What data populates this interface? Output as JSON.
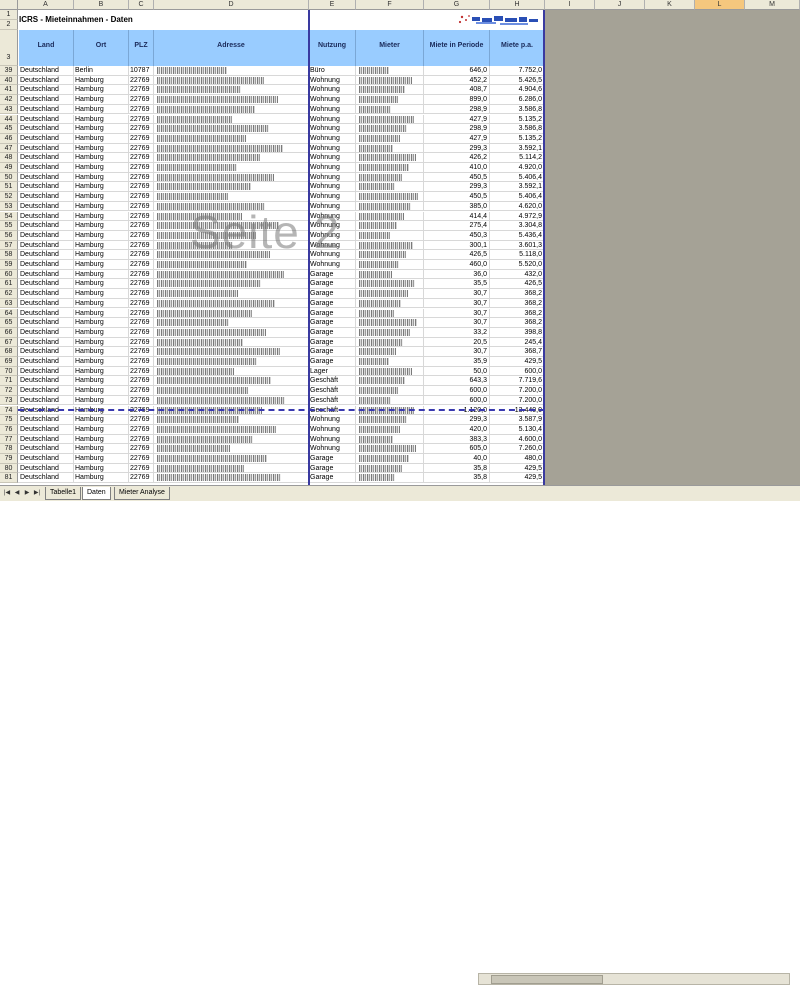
{
  "title": "ICRS - Mieteinnahmen - Daten",
  "watermark": "Seite 2",
  "columns": [
    "A",
    "B",
    "C",
    "D",
    "E",
    "F",
    "G",
    "H",
    "I",
    "J",
    "K",
    "L",
    "M"
  ],
  "selected_column": "L",
  "header_rows": [
    "1",
    "2"
  ],
  "header_label_row": "3",
  "headers": {
    "land": "Land",
    "ort": "Ort",
    "plz": "PLZ",
    "adresse": "Adresse",
    "nutzung": "Nutzung",
    "mieter": "Mieter",
    "miete_periode": "Miete in Periode",
    "miete_pa": "Miete p.a."
  },
  "rows": [
    {
      "n": "39",
      "land": "Deutschland",
      "ort": "Berlin",
      "plz": "10787",
      "nutzung": "Büro",
      "periode": "646,0",
      "pa": "7.752,0"
    },
    {
      "n": "40",
      "land": "Deutschland",
      "ort": "Hamburg",
      "plz": "22769",
      "nutzung": "Wohnung",
      "periode": "452,2",
      "pa": "5.426,5"
    },
    {
      "n": "41",
      "land": "Deutschland",
      "ort": "Hamburg",
      "plz": "22769",
      "nutzung": "Wohnung",
      "periode": "408,7",
      "pa": "4.904,6"
    },
    {
      "n": "42",
      "land": "Deutschland",
      "ort": "Hamburg",
      "plz": "22769",
      "nutzung": "Wohnung",
      "periode": "899,0",
      "pa": "6.286,0"
    },
    {
      "n": "43",
      "land": "Deutschland",
      "ort": "Hamburg",
      "plz": "22769",
      "nutzung": "Wohnung",
      "periode": "298,9",
      "pa": "3.586,8"
    },
    {
      "n": "44",
      "land": "Deutschland",
      "ort": "Hamburg",
      "plz": "22769",
      "nutzung": "Wohnung",
      "periode": "427,9",
      "pa": "5.135,2"
    },
    {
      "n": "45",
      "land": "Deutschland",
      "ort": "Hamburg",
      "plz": "22769",
      "nutzung": "Wohnung",
      "periode": "298,9",
      "pa": "3.586,8"
    },
    {
      "n": "46",
      "land": "Deutschland",
      "ort": "Hamburg",
      "plz": "22769",
      "nutzung": "Wohnung",
      "periode": "427,9",
      "pa": "5.135,2"
    },
    {
      "n": "47",
      "land": "Deutschland",
      "ort": "Hamburg",
      "plz": "22769",
      "nutzung": "Wohnung",
      "periode": "299,3",
      "pa": "3.592,1"
    },
    {
      "n": "48",
      "land": "Deutschland",
      "ort": "Hamburg",
      "plz": "22769",
      "nutzung": "Wohnung",
      "periode": "426,2",
      "pa": "5.114,2"
    },
    {
      "n": "49",
      "land": "Deutschland",
      "ort": "Hamburg",
      "plz": "22769",
      "nutzung": "Wohnung",
      "periode": "410,0",
      "pa": "4.920,0"
    },
    {
      "n": "50",
      "land": "Deutschland",
      "ort": "Hamburg",
      "plz": "22769",
      "nutzung": "Wohnung",
      "periode": "450,5",
      "pa": "5.406,4"
    },
    {
      "n": "51",
      "land": "Deutschland",
      "ort": "Hamburg",
      "plz": "22769",
      "nutzung": "Wohnung",
      "periode": "299,3",
      "pa": "3.592,1"
    },
    {
      "n": "52",
      "land": "Deutschland",
      "ort": "Hamburg",
      "plz": "22769",
      "nutzung": "Wohnung",
      "periode": "450,5",
      "pa": "5.406,4"
    },
    {
      "n": "53",
      "land": "Deutschland",
      "ort": "Hamburg",
      "plz": "22769",
      "nutzung": "Wohnung",
      "periode": "385,0",
      "pa": "4.620,0"
    },
    {
      "n": "54",
      "land": "Deutschland",
      "ort": "Hamburg",
      "plz": "22769",
      "nutzung": "Wohnung",
      "periode": "414,4",
      "pa": "4.972,9"
    },
    {
      "n": "55",
      "land": "Deutschland",
      "ort": "Hamburg",
      "plz": "22769",
      "nutzung": "Wohnung",
      "periode": "275,4",
      "pa": "3.304,8"
    },
    {
      "n": "56",
      "land": "Deutschland",
      "ort": "Hamburg",
      "plz": "22769",
      "nutzung": "Wohnung",
      "periode": "450,3",
      "pa": "5.436,4"
    },
    {
      "n": "57",
      "land": "Deutschland",
      "ort": "Hamburg",
      "plz": "22769",
      "nutzung": "Wohnung",
      "periode": "300,1",
      "pa": "3.601,3"
    },
    {
      "n": "58",
      "land": "Deutschland",
      "ort": "Hamburg",
      "plz": "22769",
      "nutzung": "Wohnung",
      "periode": "426,5",
      "pa": "5.118,0"
    },
    {
      "n": "59",
      "land": "Deutschland",
      "ort": "Hamburg",
      "plz": "22769",
      "nutzung": "Wohnung",
      "periode": "460,0",
      "pa": "5.520,0"
    },
    {
      "n": "60",
      "land": "Deutschland",
      "ort": "Hamburg",
      "plz": "22769",
      "nutzung": "Garage",
      "periode": "36,0",
      "pa": "432,0"
    },
    {
      "n": "61",
      "land": "Deutschland",
      "ort": "Hamburg",
      "plz": "22769",
      "nutzung": "Garage",
      "periode": "35,5",
      "pa": "426,5"
    },
    {
      "n": "62",
      "land": "Deutschland",
      "ort": "Hamburg",
      "plz": "22769",
      "nutzung": "Garage",
      "periode": "30,7",
      "pa": "368,2"
    },
    {
      "n": "63",
      "land": "Deutschland",
      "ort": "Hamburg",
      "plz": "22769",
      "nutzung": "Garage",
      "periode": "30,7",
      "pa": "368,2"
    },
    {
      "n": "64",
      "land": "Deutschland",
      "ort": "Hamburg",
      "plz": "22769",
      "nutzung": "Garage",
      "periode": "30,7",
      "pa": "368,2"
    },
    {
      "n": "65",
      "land": "Deutschland",
      "ort": "Hamburg",
      "plz": "22769",
      "nutzung": "Garage",
      "periode": "30,7",
      "pa": "368,2"
    },
    {
      "n": "66",
      "land": "Deutschland",
      "ort": "Hamburg",
      "plz": "22769",
      "nutzung": "Garage",
      "periode": "33,2",
      "pa": "398,8"
    },
    {
      "n": "67",
      "land": "Deutschland",
      "ort": "Hamburg",
      "plz": "22769",
      "nutzung": "Garage",
      "periode": "20,5",
      "pa": "245,4"
    },
    {
      "n": "68",
      "land": "Deutschland",
      "ort": "Hamburg",
      "plz": "22769",
      "nutzung": "Garage",
      "periode": "30,7",
      "pa": "368,7"
    },
    {
      "n": "69",
      "land": "Deutschland",
      "ort": "Hamburg",
      "plz": "22769",
      "nutzung": "Garage",
      "periode": "35,9",
      "pa": "429,5"
    },
    {
      "n": "70",
      "land": "Deutschland",
      "ort": "Hamburg",
      "plz": "22769",
      "nutzung": "Lager",
      "periode": "50,0",
      "pa": "600,0"
    },
    {
      "n": "71",
      "land": "Deutschland",
      "ort": "Hamburg",
      "plz": "22769",
      "nutzung": "Geschäft",
      "periode": "643,3",
      "pa": "7.719,6"
    },
    {
      "n": "72",
      "land": "Deutschland",
      "ort": "Hamburg",
      "plz": "22769",
      "nutzung": "Geschäft",
      "periode": "600,0",
      "pa": "7.200,0"
    },
    {
      "n": "73",
      "land": "Deutschland",
      "ort": "Hamburg",
      "plz": "22769",
      "nutzung": "Geschäft",
      "periode": "600,0",
      "pa": "7.200,0"
    },
    {
      "n": "74",
      "land": "Deutschland",
      "ort": "Hamburg",
      "plz": "22769",
      "nutzung": "Geschäft",
      "periode": "1.120,0",
      "pa": "13.440,0"
    },
    {
      "n": "75",
      "land": "Deutschland",
      "ort": "Hamburg",
      "plz": "22769",
      "nutzung": "Wohnung",
      "periode": "299,3",
      "pa": "3.587,9"
    },
    {
      "n": "76",
      "land": "Deutschland",
      "ort": "Hamburg",
      "plz": "22769",
      "nutzung": "Wohnung",
      "periode": "420,0",
      "pa": "5.130,4"
    },
    {
      "n": "77",
      "land": "Deutschland",
      "ort": "Hamburg",
      "plz": "22769",
      "nutzung": "Wohnung",
      "periode": "383,3",
      "pa": "4.600,0"
    },
    {
      "n": "78",
      "land": "Deutschland",
      "ort": "Hamburg",
      "plz": "22769",
      "nutzung": "Wohnung",
      "periode": "605,0",
      "pa": "7.260,0"
    },
    {
      "n": "79",
      "land": "Deutschland",
      "ort": "Hamburg",
      "plz": "22769",
      "nutzung": "Garage",
      "periode": "40,0",
      "pa": "480,0"
    },
    {
      "n": "80",
      "land": "Deutschland",
      "ort": "Hamburg",
      "plz": "22769",
      "nutzung": "Garage",
      "periode": "35,8",
      "pa": "429,5"
    },
    {
      "n": "81",
      "land": "Deutschland",
      "ort": "Hamburg",
      "plz": "22769",
      "nutzung": "Garage",
      "periode": "35,8",
      "pa": "429,5"
    }
  ],
  "sheet_tabs": [
    {
      "label": "Tabelle1",
      "active": false
    },
    {
      "label": "Daten",
      "active": true
    },
    {
      "label": "Mieter Analyse",
      "active": false
    }
  ],
  "colors": {
    "header_fill": "#99ccff",
    "grid_bg": "#a5a296",
    "print_border": "#3a3aa0"
  }
}
